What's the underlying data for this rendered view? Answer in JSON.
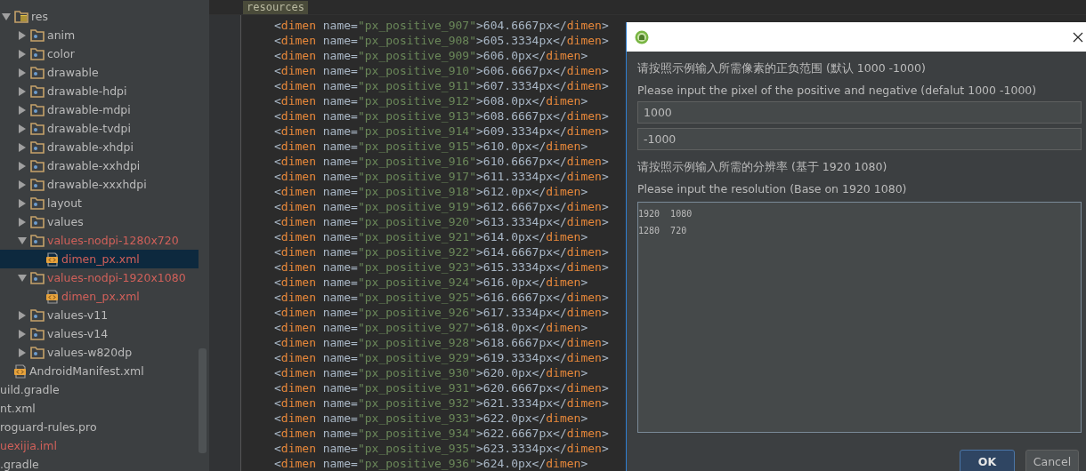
{
  "project_tree": {
    "items": [
      {
        "label": "res",
        "kind": "res-folder",
        "expanded": true,
        "untracked": false,
        "selected": false,
        "children": [
          {
            "label": "anim",
            "kind": "folder",
            "expanded": false,
            "untracked": false,
            "selected": false
          },
          {
            "label": "color",
            "kind": "folder",
            "expanded": false,
            "untracked": false,
            "selected": false
          },
          {
            "label": "drawable",
            "kind": "folder",
            "expanded": false,
            "untracked": false,
            "selected": false
          },
          {
            "label": "drawable-hdpi",
            "kind": "folder",
            "expanded": false,
            "untracked": false,
            "selected": false
          },
          {
            "label": "drawable-mdpi",
            "kind": "folder",
            "expanded": false,
            "untracked": false,
            "selected": false
          },
          {
            "label": "drawable-tvdpi",
            "kind": "folder",
            "expanded": false,
            "untracked": false,
            "selected": false
          },
          {
            "label": "drawable-xhdpi",
            "kind": "folder",
            "expanded": false,
            "untracked": false,
            "selected": false
          },
          {
            "label": "drawable-xxhdpi",
            "kind": "folder",
            "expanded": false,
            "untracked": false,
            "selected": false
          },
          {
            "label": "drawable-xxxhdpi",
            "kind": "folder",
            "expanded": false,
            "untracked": false,
            "selected": false
          },
          {
            "label": "layout",
            "kind": "folder",
            "expanded": false,
            "untracked": false,
            "selected": false
          },
          {
            "label": "values",
            "kind": "folder",
            "expanded": false,
            "untracked": false,
            "selected": false
          },
          {
            "label": "values-nodpi-1280x720",
            "kind": "folder",
            "expanded": true,
            "untracked": true,
            "selected": false,
            "children": [
              {
                "label": "dimen_px.xml",
                "kind": "xml-file",
                "untracked": true,
                "selected": true
              }
            ]
          },
          {
            "label": "values-nodpi-1920x1080",
            "kind": "folder",
            "expanded": true,
            "untracked": true,
            "selected": false,
            "children": [
              {
                "label": "dimen_px.xml",
                "kind": "xml-file",
                "untracked": true,
                "selected": false
              }
            ]
          },
          {
            "label": "values-v11",
            "kind": "folder",
            "expanded": false,
            "untracked": false,
            "selected": false
          },
          {
            "label": "values-v14",
            "kind": "folder",
            "expanded": false,
            "untracked": false,
            "selected": false
          },
          {
            "label": "values-w820dp",
            "kind": "folder",
            "expanded": false,
            "untracked": false,
            "selected": false
          }
        ]
      },
      {
        "label": "AndroidManifest.xml",
        "kind": "xml-file",
        "untracked": false,
        "selected": false
      }
    ],
    "outer_items": [
      {
        "label": "uild.gradle",
        "untracked": false,
        "selected": false
      },
      {
        "label": "nt.xml",
        "untracked": false,
        "selected": false
      },
      {
        "label": "roguard-rules.pro",
        "untracked": false,
        "selected": false
      },
      {
        "label": "uexijia.iml",
        "untracked": true,
        "selected": false
      },
      {
        "label": ".gradle",
        "untracked": false,
        "selected": false
      }
    ]
  },
  "editor": {
    "breadcrumb": "resources",
    "lines": [
      "<dimen name=\"px_positive_907\">604.6667px</dimen>",
      "<dimen name=\"px_positive_908\">605.3334px</dimen>",
      "<dimen name=\"px_positive_909\">606.0px</dimen>",
      "<dimen name=\"px_positive_910\">606.6667px</dimen>",
      "<dimen name=\"px_positive_911\">607.3334px</dimen>",
      "<dimen name=\"px_positive_912\">608.0px</dimen>",
      "<dimen name=\"px_positive_913\">608.6667px</dimen>",
      "<dimen name=\"px_positive_914\">609.3334px</dimen>",
      "<dimen name=\"px_positive_915\">610.0px</dimen>",
      "<dimen name=\"px_positive_916\">610.6667px</dimen>",
      "<dimen name=\"px_positive_917\">611.3334px</dimen>",
      "<dimen name=\"px_positive_918\">612.0px</dimen>",
      "<dimen name=\"px_positive_919\">612.6667px</dimen>",
      "<dimen name=\"px_positive_920\">613.3334px</dimen>",
      "<dimen name=\"px_positive_921\">614.0px</dimen>",
      "<dimen name=\"px_positive_922\">614.6667px</dimen>",
      "<dimen name=\"px_positive_923\">615.3334px</dimen>",
      "<dimen name=\"px_positive_924\">616.0px</dimen>",
      "<dimen name=\"px_positive_925\">616.6667px</dimen>",
      "<dimen name=\"px_positive_926\">617.3334px</dimen>",
      "<dimen name=\"px_positive_927\">618.0px</dimen>",
      "<dimen name=\"px_positive_928\">618.6667px</dimen>",
      "<dimen name=\"px_positive_929\">619.3334px</dimen>",
      "<dimen name=\"px_positive_930\">620.0px</dimen>",
      "<dimen name=\"px_positive_931\">620.6667px</dimen>",
      "<dimen name=\"px_positive_932\">621.3334px</dimen>",
      "<dimen name=\"px_positive_933\">622.0px</dimen>",
      "<dimen name=\"px_positive_934\">622.6667px</dimen>",
      "<dimen name=\"px_positive_935\">623.3334px</dimen>",
      "<dimen name=\"px_positive_936\">624.0px</dimen>"
    ]
  },
  "dialog": {
    "range_label_zh": "请按照示例输入所需像素的正负范围 (默认 1000 -1000)",
    "range_label_en": "Please input the pixel of the positive and negative (defalut 1000 -1000)",
    "positive_value": "1000",
    "negative_value": "-1000",
    "resolution_label_zh": "请按照示例输入所需的分辨率 (基于 1920 1080)",
    "resolution_label_en": "Please input the resolution (Base on 1920 1080)",
    "resolutions": [
      "1920  1080",
      "1280  720"
    ],
    "buttons": [
      {
        "label": "OK",
        "kind": "default"
      },
      {
        "label": "Cancel",
        "kind": "normal"
      }
    ]
  }
}
